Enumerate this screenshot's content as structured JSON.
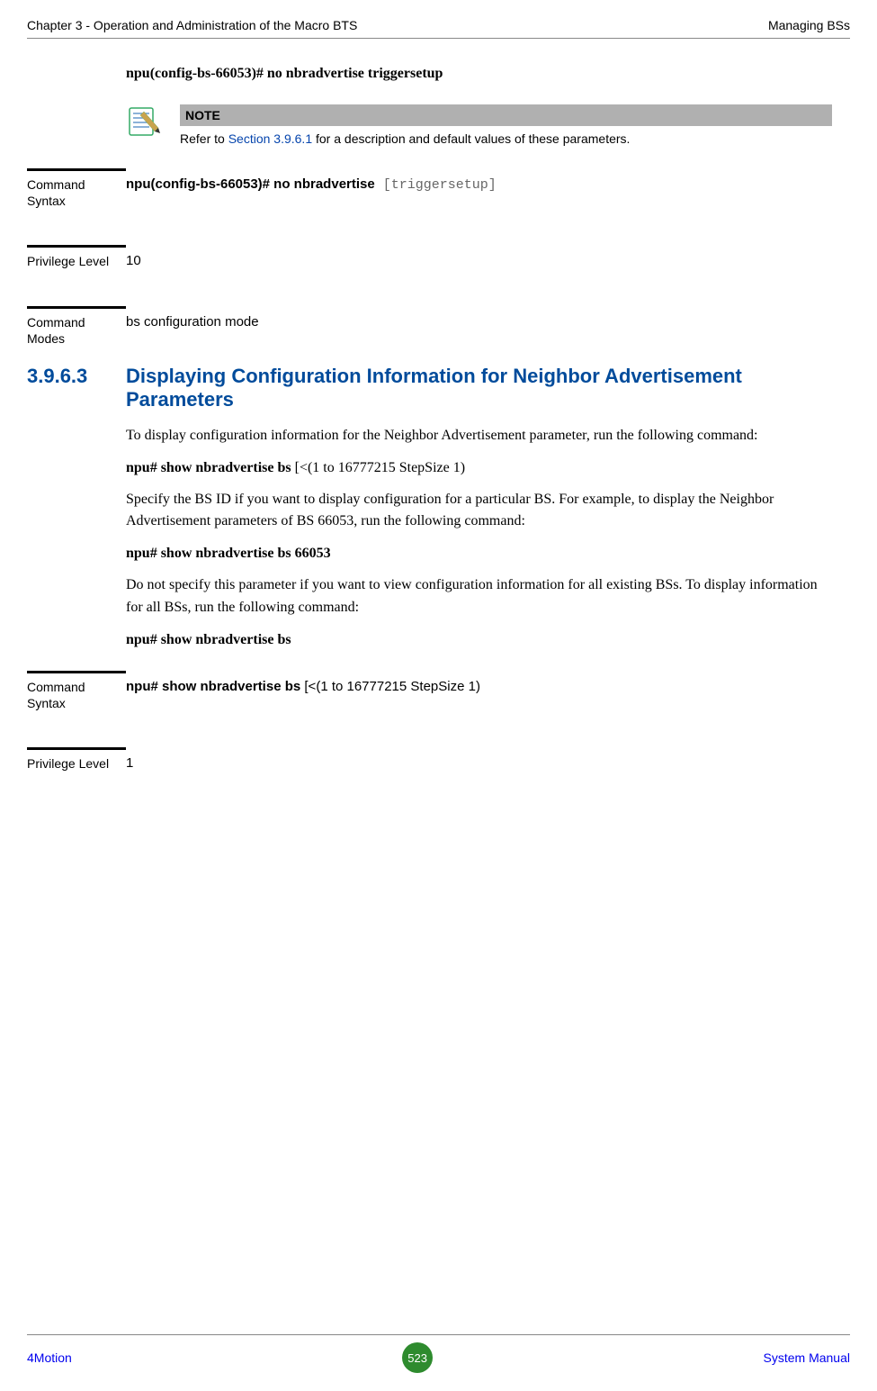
{
  "header": {
    "left": "Chapter 3 - Operation and Administration of the Macro BTS",
    "right": "Managing BSs"
  },
  "top_cmd": "npu(config-bs-66053)# no nbradvertise triggersetup",
  "note": {
    "title": "NOTE",
    "pre": "Refer to ",
    "link": "Section 3.9.6.1",
    "post": " for a description and default values of these parameters."
  },
  "rows1": {
    "syntax_label": "Command Syntax",
    "syntax_bold": "npu(config-bs-66053)# no nbradvertise",
    "syntax_mono": " [triggersetup]",
    "priv_label": "Privilege Level",
    "priv_value": "10",
    "modes_label": "Command Modes",
    "modes_value": "bs configuration mode"
  },
  "section": {
    "num": "3.9.6.3",
    "title": "Displaying Configuration Information for Neighbor Advertisement Parameters"
  },
  "body": {
    "p1": "To display configuration information for the Neighbor Advertisement parameter, run the following command:",
    "c1a": "npu# show nbradvertise bs ",
    "c1b": "[<(1 to 16777215 StepSize 1)",
    "p2": "Specify the BS ID if you want to display configuration for a particular BS. For example, to display the Neighbor Advertisement parameters of BS 66053, run the following command:",
    "c2": "npu# show nbradvertise bs 66053",
    "p3": "Do not specify this parameter if you want to view configuration information for all existing BSs. To display information for all BSs, run the following command:",
    "c3": "npu# show nbradvertise bs"
  },
  "rows2": {
    "syntax_label": "Command Syntax",
    "syntax_bold": "npu# show nbradvertise bs ",
    "syntax_rest": "[<(1 to 16777215 StepSize 1)",
    "priv_label": "Privilege Level",
    "priv_value": "1"
  },
  "footer": {
    "left": "4Motion",
    "center": "523",
    "right": "System Manual"
  }
}
